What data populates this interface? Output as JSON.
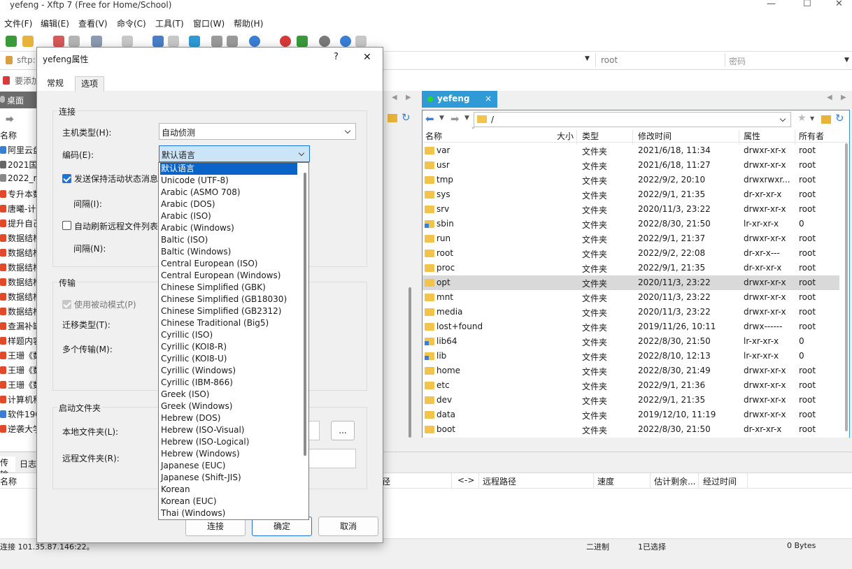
{
  "window": {
    "title": "yefeng - Xftp 7 (Free for Home/School)"
  },
  "menu": [
    "文件(F)",
    "编辑(E)",
    "查看(V)",
    "命令(C)",
    "工具(T)",
    "窗口(W)",
    "帮助(H)"
  ],
  "address": {
    "protocol": "sftp:",
    "username": "root",
    "password_placeholder": "密码"
  },
  "hint": "要添加",
  "left_tab": "桌面",
  "left_pane": {
    "header": "名称",
    "items": [
      {
        "label": "阿里云盘",
        "color": "#3a7fd5"
      },
      {
        "label": "2021国家",
        "color": "#666666"
      },
      {
        "label": "2022_m",
        "color": "#888888"
      },
      {
        "label": "专升本数",
        "color": "#e04a2b"
      },
      {
        "label": "唐曦-计算",
        "color": "#e04a2b"
      },
      {
        "label": "提升自己",
        "color": "#e04a2b"
      },
      {
        "label": "数据结构",
        "color": "#e04a2b"
      },
      {
        "label": "数据结构",
        "color": "#e04a2b"
      },
      {
        "label": "数据结构",
        "color": "#e04a2b"
      },
      {
        "label": "数据结构",
        "color": "#e04a2b"
      },
      {
        "label": "数据结构",
        "color": "#e04a2b"
      },
      {
        "label": "数据结构",
        "color": "#e04a2b"
      },
      {
        "label": "查漏补缺",
        "color": "#e04a2b"
      },
      {
        "label": "样题内容",
        "color": "#e04a2b"
      },
      {
        "label": "王珊《数",
        "color": "#e04a2b"
      },
      {
        "label": "王珊《数",
        "color": "#e04a2b"
      },
      {
        "label": "王珊《数",
        "color": "#e04a2b"
      },
      {
        "label": "计算机科",
        "color": "#e04a2b"
      },
      {
        "label": "软件190",
        "color": "#3a7fd5"
      },
      {
        "label": "逆袭大学",
        "color": "#e04a2b"
      }
    ]
  },
  "right_tab": {
    "label": "yefeng",
    "close": "×"
  },
  "right_path": "/",
  "right_columns": [
    "名称",
    "大小",
    "类型",
    "修改时间",
    "属性",
    "所有者"
  ],
  "right_files": [
    {
      "name": "var",
      "size": "",
      "type": "文件夹",
      "mtime": "2021/6/18, 11:34",
      "attr": "drwxr-xr-x",
      "owner": "root",
      "link": false
    },
    {
      "name": "usr",
      "size": "",
      "type": "文件夹",
      "mtime": "2021/6/18, 11:27",
      "attr": "drwxr-xr-x",
      "owner": "root",
      "link": false
    },
    {
      "name": "tmp",
      "size": "",
      "type": "文件夹",
      "mtime": "2022/9/2, 20:10",
      "attr": "drwxrwxr...",
      "owner": "root",
      "link": false
    },
    {
      "name": "sys",
      "size": "",
      "type": "文件夹",
      "mtime": "2022/9/1, 21:35",
      "attr": "dr-xr-xr-x",
      "owner": "root",
      "link": false
    },
    {
      "name": "srv",
      "size": "",
      "type": "文件夹",
      "mtime": "2020/11/3, 23:22",
      "attr": "drwxr-xr-x",
      "owner": "root",
      "link": false
    },
    {
      "name": "sbin",
      "size": "",
      "type": "文件夹",
      "mtime": "2022/8/30, 21:50",
      "attr": "lr-xr-xr-x",
      "owner": "0",
      "link": true
    },
    {
      "name": "run",
      "size": "",
      "type": "文件夹",
      "mtime": "2022/9/1, 21:37",
      "attr": "drwxr-xr-x",
      "owner": "root",
      "link": false
    },
    {
      "name": "root",
      "size": "",
      "type": "文件夹",
      "mtime": "2022/9/2, 22:08",
      "attr": "dr-xr-x---",
      "owner": "root",
      "link": false
    },
    {
      "name": "proc",
      "size": "",
      "type": "文件夹",
      "mtime": "2022/9/1, 21:35",
      "attr": "dr-xr-xr-x",
      "owner": "root",
      "link": false
    },
    {
      "name": "opt",
      "size": "",
      "type": "文件夹",
      "mtime": "2020/11/3, 23:22",
      "attr": "drwxr-xr-x",
      "owner": "root",
      "link": false,
      "selected": true
    },
    {
      "name": "mnt",
      "size": "",
      "type": "文件夹",
      "mtime": "2020/11/3, 23:22",
      "attr": "drwxr-xr-x",
      "owner": "root",
      "link": false
    },
    {
      "name": "media",
      "size": "",
      "type": "文件夹",
      "mtime": "2020/11/3, 23:22",
      "attr": "drwxr-xr-x",
      "owner": "root",
      "link": false
    },
    {
      "name": "lost+found",
      "size": "",
      "type": "文件夹",
      "mtime": "2019/11/26, 10:11",
      "attr": "drwx------",
      "owner": "root",
      "link": false
    },
    {
      "name": "lib64",
      "size": "",
      "type": "文件夹",
      "mtime": "2022/8/30, 21:50",
      "attr": "lr-xr-xr-x",
      "owner": "0",
      "link": true
    },
    {
      "name": "lib",
      "size": "",
      "type": "文件夹",
      "mtime": "2022/8/10, 12:13",
      "attr": "lr-xr-xr-x",
      "owner": "0",
      "link": true
    },
    {
      "name": "home",
      "size": "",
      "type": "文件夹",
      "mtime": "2022/8/30, 21:49",
      "attr": "drwxr-xr-x",
      "owner": "root",
      "link": false
    },
    {
      "name": "etc",
      "size": "",
      "type": "文件夹",
      "mtime": "2022/9/1, 21:36",
      "attr": "drwxr-xr-x",
      "owner": "root",
      "link": false
    },
    {
      "name": "dev",
      "size": "",
      "type": "文件夹",
      "mtime": "2022/9/1, 21:35",
      "attr": "drwxr-xr-x",
      "owner": "root",
      "link": false
    },
    {
      "name": "data",
      "size": "",
      "type": "文件夹",
      "mtime": "2019/12/10, 11:19",
      "attr": "drwxr-xr-x",
      "owner": "root",
      "link": false
    },
    {
      "name": "boot",
      "size": "",
      "type": "文件夹",
      "mtime": "2022/8/30, 21:50",
      "attr": "dr-xr-xr-x",
      "owner": "root",
      "link": false
    }
  ],
  "transfer": {
    "tabs": [
      "传输",
      "日志"
    ],
    "columns": [
      "名称",
      "径",
      "<->",
      "远程路径",
      "速度",
      "估计剩余...",
      "经过时间"
    ]
  },
  "status": {
    "left": "连接 101.35.87.146:22。",
    "mode": "二进制",
    "selected": "1已选择",
    "bytes": "0 Bytes"
  },
  "dialog": {
    "title": "yefeng属性",
    "help": "?",
    "close": "✕",
    "tabs": [
      "常规",
      "选项"
    ],
    "active_tab": 1,
    "conn_group": "连接",
    "host_type_label": "主机类型(H):",
    "host_type_value": "自动侦测",
    "encoding_label": "编码(E):",
    "encoding_value": "默认语言",
    "keepalive_label": "发送保持活动状态消息",
    "keepalive_checked": true,
    "interval1_label": "间隔(I):",
    "autorefresh_label": "自动刷新远程文件列表",
    "autorefresh_checked": false,
    "interval2_label": "间隔(N):",
    "transfer_group": "传输",
    "passive_label": "使用被动模式(P)",
    "passive_checked": true,
    "migrate_label": "迁移类型(T):",
    "multi_label": "多个传输(M):",
    "startup_group": "启动文件夹",
    "local_folder_label": "本地文件夹(L):",
    "remote_folder_label": "远程文件夹(R):",
    "browse_label": "...",
    "connect_button": "连接",
    "ok_button": "确定",
    "cancel_button": "取消"
  },
  "encoding_options": [
    "默认语言",
    "Unicode (UTF-8)",
    "Arabic (ASMO 708)",
    "Arabic (DOS)",
    "Arabic (ISO)",
    "Arabic (Windows)",
    "Baltic (ISO)",
    "Baltic (Windows)",
    "Central European (ISO)",
    "Central European (Windows)",
    "Chinese Simplified (GBK)",
    "Chinese Simplified (GB18030)",
    "Chinese Simplified (GB2312)",
    "Chinese Traditional (Big5)",
    "Cyrillic (ISO)",
    "Cyrillic (KOI8-R)",
    "Cyrillic (KOI8-U)",
    "Cyrillic (Windows)",
    "Cyrillic (IBM-866)",
    "Greek (ISO)",
    "Greek (Windows)",
    "Hebrew (DOS)",
    "Hebrew (ISO-Visual)",
    "Hebrew (ISO-Logical)",
    "Hebrew (Windows)",
    "Japanese (EUC)",
    "Japanese (Shift-JIS)",
    "Korean",
    "Korean (EUC)",
    "Thai (Windows)"
  ],
  "encoding_selected_index": 0,
  "colors": {
    "accent": "#2f9ad6",
    "selection": "#0a64c8",
    "folder": "#f3c44b"
  }
}
